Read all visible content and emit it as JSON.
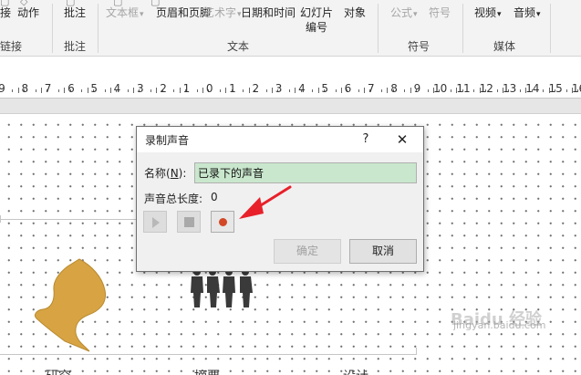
{
  "ribbon": {
    "stub_left": "接",
    "action": "动作",
    "comment": "批注",
    "textbox": "文本框",
    "header_footer": "页眉和页脚",
    "wordart": "艺术字",
    "date_time": "日期和时间",
    "slide_number_line1": "幻灯片",
    "slide_number_line2": "编号",
    "object": "对象",
    "equation": "公式",
    "symbol": "符号",
    "video": "视频",
    "audio": "音频",
    "groups": {
      "links": "链接",
      "comments": "批注",
      "text": "文本",
      "symbols": "符号",
      "media": "媒体"
    }
  },
  "ruler": {
    "labels": [
      "9",
      "8",
      "7",
      "6",
      "5",
      "4",
      "3",
      "2",
      "1",
      "0",
      "1",
      "2",
      "3",
      "4",
      "5",
      "6",
      "7",
      "8",
      "9",
      "10",
      "11",
      "12",
      "13",
      "14",
      "15",
      "16"
    ]
  },
  "dialog": {
    "title": "录制声音",
    "help": "?",
    "close": "✕",
    "name_label_pre": "名称(",
    "name_label_key": "N",
    "name_label_post": "):",
    "name_value": "已录下的声音",
    "length_label": "声音总长度:",
    "length_value": "0",
    "ok": "确定",
    "cancel": "取消"
  },
  "slide": {
    "labels": [
      "研究",
      "摘要",
      "设计"
    ]
  },
  "watermark": {
    "line1": "Baidu 经验",
    "line2": "jingyan.baidu.com"
  },
  "colors": {
    "name_field_bg": "#c9e7cd",
    "record_dot": "#d24726",
    "arrow": "#e8202a",
    "shape_gold": "#d8a443"
  }
}
